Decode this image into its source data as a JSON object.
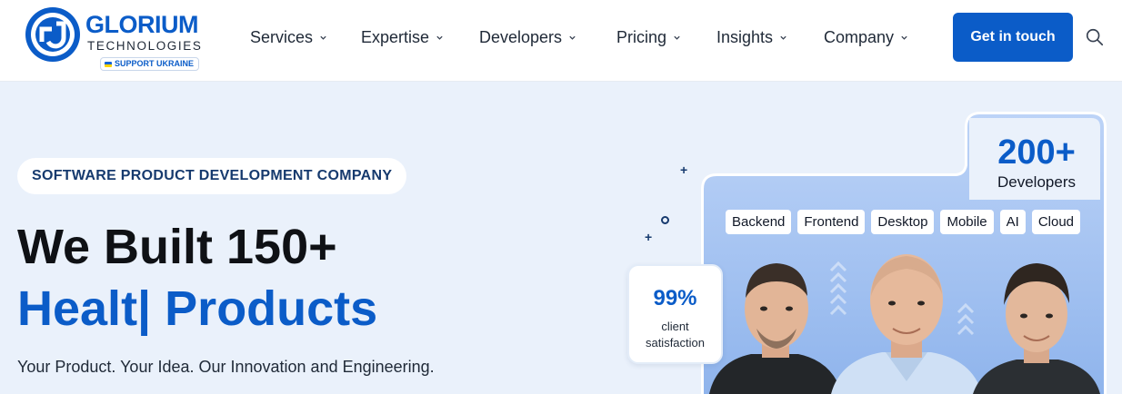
{
  "header": {
    "logo": {
      "name": "GLORIUM",
      "subtitle": "TECHNOLOGIES",
      "badge": "SUPPORT UKRAINE",
      "brand_color": "#0b5cc8"
    },
    "nav": [
      {
        "label": "Services",
        "icon": "chevron-down-icon"
      },
      {
        "label": "Expertise",
        "icon": "chevron-down-icon"
      },
      {
        "label": "Developers",
        "icon": "chevron-down-icon"
      },
      {
        "label": "Pricing",
        "icon": "chevron-down-icon"
      },
      {
        "label": "Insights",
        "icon": "chevron-down-icon"
      },
      {
        "label": "Company",
        "icon": "chevron-down-icon"
      }
    ],
    "cta_label": "Get in touch",
    "search_icon": "search-icon"
  },
  "hero": {
    "tag": "SOFTWARE PRODUCT DEVELOPMENT COMPANY",
    "title_line1": "We Built 150+",
    "title_line2": "Healt| Products",
    "subtitle": "Your Product. Your Idea. Our Innovation and Engineering.",
    "accent_color": "#0b5cc8"
  },
  "team_card": {
    "stat_value": "200+",
    "stat_label": "Developers",
    "chips": [
      "Backend",
      "Frontend",
      "Desktop",
      "Mobile",
      "AI",
      "Cloud"
    ],
    "satisfaction_value": "99%",
    "satisfaction_label_1": "client",
    "satisfaction_label_2": "satisfaction"
  }
}
